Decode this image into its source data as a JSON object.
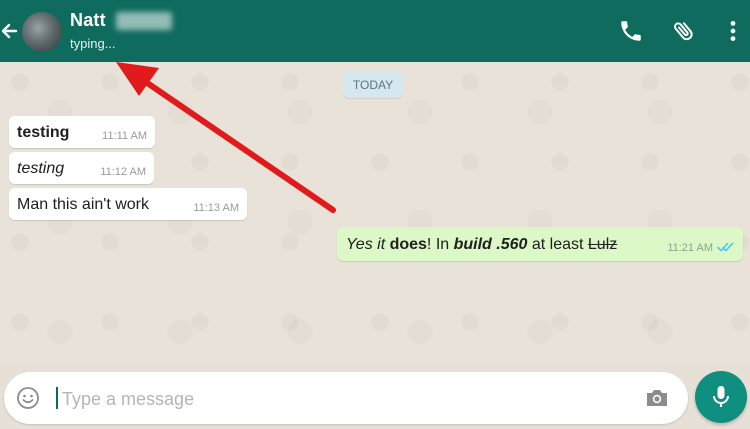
{
  "header": {
    "contact_name": "Natt",
    "status": "typing..."
  },
  "chat": {
    "date_label": "TODAY",
    "incoming": [
      {
        "text": "testing",
        "time": "11:11 AM",
        "style": "bold"
      },
      {
        "text": "testing",
        "time": "11:12 AM",
        "style": "italic"
      },
      {
        "text": "Man this ain't work",
        "time": "11:13 AM",
        "style": "normal"
      }
    ],
    "outgoing": {
      "parts": {
        "p1": "Yes it ",
        "p2": "does",
        "p3": "! In ",
        "p4": "build .560",
        "p5": " at least ",
        "p6": "Lulz"
      },
      "time": "11:21 AM"
    }
  },
  "input": {
    "placeholder": "Type a message",
    "value": ""
  },
  "icons": {
    "back": "arrow-left-icon",
    "call": "phone-icon",
    "attach": "paperclip-icon",
    "more": "more-vert-icon",
    "emoji": "emoji-icon",
    "camera": "camera-icon",
    "mic": "mic-icon",
    "read": "double-check-icon"
  },
  "colors": {
    "header": "#0f6b5e",
    "outgoing_bubble": "#dcf8c6",
    "incoming_bubble": "#ffffff",
    "mic_button": "#0f8f7f",
    "annotation_arrow": "#e11b1b",
    "read_ticks": "#4fc3f7"
  }
}
